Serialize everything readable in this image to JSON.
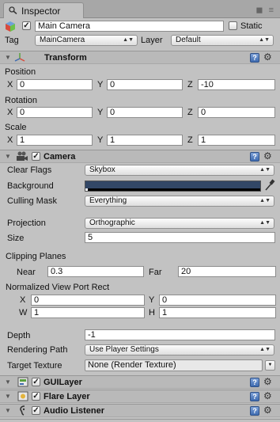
{
  "window": {
    "tab_title": "Inspector",
    "corner_icons": "◼ ≡"
  },
  "object": {
    "name": "Main Camera",
    "active": true,
    "static_label": "Static",
    "static": false,
    "tag_label": "Tag",
    "tag_value": "MainCamera",
    "layer_label": "Layer",
    "layer_value": "Default"
  },
  "transform": {
    "title": "Transform",
    "position_label": "Position",
    "position": {
      "x": "0",
      "y": "0",
      "z": "-10"
    },
    "rotation_label": "Rotation",
    "rotation": {
      "x": "0",
      "y": "0",
      "z": "0"
    },
    "scale_label": "Scale",
    "scale": {
      "x": "1",
      "y": "1",
      "z": "1"
    },
    "axis_x": "X",
    "axis_y": "Y",
    "axis_z": "Z"
  },
  "camera": {
    "title": "Camera",
    "enabled": true,
    "clear_flags_label": "Clear Flags",
    "clear_flags": "Skybox",
    "background_label": "Background",
    "background_color": "#324766",
    "culling_mask_label": "Culling Mask",
    "culling_mask": "Everything",
    "projection_label": "Projection",
    "projection": "Orthographic",
    "size_label": "Size",
    "size": "5",
    "clipping_label": "Clipping Planes",
    "near_label": "Near",
    "near": "0.3",
    "far_label": "Far",
    "far": "20",
    "viewport_label": "Normalized View Port Rect",
    "viewport": {
      "x": "0",
      "y": "0",
      "w": "1",
      "h": "1"
    },
    "vp_x": "X",
    "vp_y": "Y",
    "vp_w": "W",
    "vp_h": "H",
    "depth_label": "Depth",
    "depth": "-1",
    "rendering_path_label": "Rendering Path",
    "rendering_path": "Use Player Settings",
    "target_texture_label": "Target Texture",
    "target_texture": "None (Render Texture)"
  },
  "components": [
    {
      "title": "GUILayer",
      "enabled": true
    },
    {
      "title": "Flare Layer",
      "enabled": true
    },
    {
      "title": "Audio Listener",
      "enabled": true
    }
  ],
  "help_glyph": "?",
  "gear_glyph": "⚙",
  "check_glyph": "✓",
  "fold_glyph": "▼",
  "popup_arrow": "▲▼",
  "icons": [
    "cube-icon",
    "transform-axes-icon",
    "camera-icon",
    "gui-layer-icon",
    "flare-layer-icon",
    "audio-listener-icon",
    "eyedropper-icon",
    "help-icon",
    "gear-icon"
  ]
}
